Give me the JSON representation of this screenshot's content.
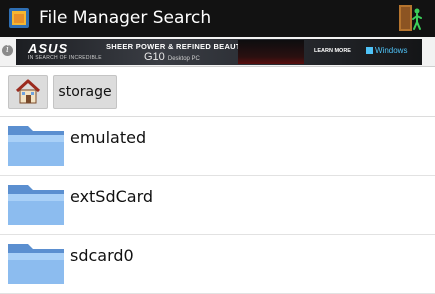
{
  "app": {
    "title": "File Manager Search",
    "icon": "app-folder-icon",
    "exit_icon": "exit-door-icon"
  },
  "ad": {
    "info_label": "i",
    "brand": "ASUS",
    "brand_tagline": "IN SEARCH OF INCREDIBLE",
    "headline": "SHEER POWER & REFINED BEAUTY",
    "model": "G10",
    "model_sub": "Desktop PC",
    "cta": "LEARN MORE",
    "windows_label": "Windows"
  },
  "breadcrumb": {
    "home_icon": "home-icon",
    "current": "storage"
  },
  "folders": [
    {
      "name": "emulated"
    },
    {
      "name": "extSdCard"
    },
    {
      "name": "sdcard0"
    }
  ],
  "colors": {
    "appbar": "#121212",
    "folder": "#6fa3e0",
    "button": "#dcdcdc"
  }
}
